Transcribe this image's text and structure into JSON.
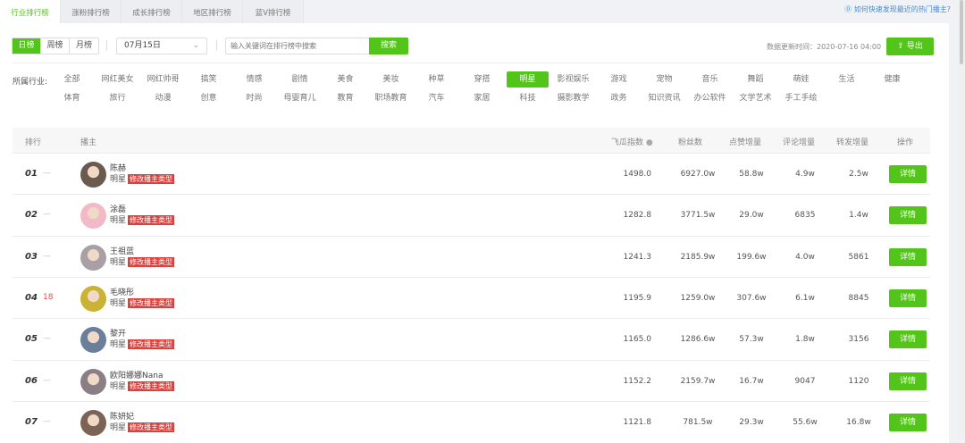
{
  "tabs": [
    "行业排行榜",
    "涨粉排行榜",
    "成长排行榜",
    "地区排行榜",
    "蓝V排行榜"
  ],
  "help_link": "⓪ 如何快速发现最近的热门播主?",
  "period": [
    "日榜",
    "周榜",
    "月榜"
  ],
  "date": "07月15日",
  "search": {
    "placeholder": "输入关键词在排行榜中搜索",
    "button": "搜索"
  },
  "update_time": "数据更新时间：2020-07-16 04:00",
  "export": "导出",
  "industry_label": "所属行业:",
  "categories_row1": [
    "全部",
    "网红美女",
    "网红帅哥",
    "搞笑",
    "情感",
    "剧情",
    "美食",
    "美妆",
    "种草",
    "穿搭",
    "明星",
    "影视娱乐",
    "游戏",
    "宠物",
    "音乐",
    "舞蹈",
    "萌娃",
    "生活",
    "健康"
  ],
  "categories_row2": [
    "体育",
    "旅行",
    "动漫",
    "创意",
    "时尚",
    "母婴育儿",
    "教育",
    "职场教育",
    "汽车",
    "家居",
    "科技",
    "摄影教学",
    "政务",
    "知识资讯",
    "办公软件",
    "文学艺术",
    "手工手绘"
  ],
  "selected_category": "明星",
  "headers": {
    "rank": "排行",
    "host": "播主",
    "index": "飞瓜指数",
    "fans": "粉丝数",
    "likes": "点赞增量",
    "comments": "评论增量",
    "shares": "转发增量",
    "action": "操作"
  },
  "tag_label": "修改播主类型",
  "detail_label": "详情",
  "rows": [
    {
      "rank": "01",
      "change": "—",
      "name": "陈赫",
      "type": "明星",
      "index": "1498.0",
      "fans": "6927.0w",
      "likes": "58.8w",
      "comments": "4.9w",
      "shares": "2.5w",
      "color": "#6b5a4e"
    },
    {
      "rank": "02",
      "change": "—",
      "name": "涂磊",
      "type": "明星",
      "index": "1282.8",
      "fans": "3771.5w",
      "likes": "29.0w",
      "comments": "6835",
      "shares": "1.4w",
      "color": "#f2b9c6"
    },
    {
      "rank": "03",
      "change": "—",
      "name": "王祖蓝",
      "type": "明星",
      "index": "1241.3",
      "fans": "2185.9w",
      "likes": "199.6w",
      "comments": "4.0w",
      "shares": "5861",
      "color": "#a9a0a6"
    },
    {
      "rank": "04",
      "change": "18",
      "name": "毛晓彤",
      "type": "明星",
      "index": "1195.9",
      "fans": "1259.0w",
      "likes": "307.6w",
      "comments": "6.1w",
      "shares": "8845",
      "color": "#c9b236"
    },
    {
      "rank": "05",
      "change": "—",
      "name": "黎开",
      "type": "明星",
      "index": "1165.0",
      "fans": "1286.6w",
      "likes": "57.3w",
      "comments": "1.8w",
      "shares": "3156",
      "color": "#6b7e9a"
    },
    {
      "rank": "06",
      "change": "—",
      "name": "欧阳娜娜Nana",
      "type": "明星",
      "index": "1152.2",
      "fans": "2159.7w",
      "likes": "16.7w",
      "comments": "9047",
      "shares": "1120",
      "color": "#8a7f86"
    },
    {
      "rank": "07",
      "change": "—",
      "name": "陈妍妃",
      "type": "明星",
      "index": "1121.8",
      "fans": "781.5w",
      "likes": "29.3w",
      "comments": "55.6w",
      "shares": "16.8w",
      "color": "#7b6455"
    }
  ]
}
